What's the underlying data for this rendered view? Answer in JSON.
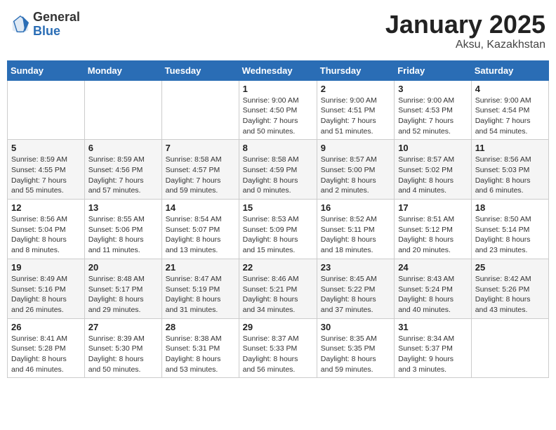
{
  "header": {
    "logo_general": "General",
    "logo_blue": "Blue",
    "month_title": "January 2025",
    "location": "Aksu, Kazakhstan"
  },
  "weekdays": [
    "Sunday",
    "Monday",
    "Tuesday",
    "Wednesday",
    "Thursday",
    "Friday",
    "Saturday"
  ],
  "weeks": [
    [
      {
        "day": "",
        "sunrise": "",
        "sunset": "",
        "daylight": ""
      },
      {
        "day": "",
        "sunrise": "",
        "sunset": "",
        "daylight": ""
      },
      {
        "day": "",
        "sunrise": "",
        "sunset": "",
        "daylight": ""
      },
      {
        "day": "1",
        "sunrise": "Sunrise: 9:00 AM",
        "sunset": "Sunset: 4:50 PM",
        "daylight": "Daylight: 7 hours and 50 minutes."
      },
      {
        "day": "2",
        "sunrise": "Sunrise: 9:00 AM",
        "sunset": "Sunset: 4:51 PM",
        "daylight": "Daylight: 7 hours and 51 minutes."
      },
      {
        "day": "3",
        "sunrise": "Sunrise: 9:00 AM",
        "sunset": "Sunset: 4:53 PM",
        "daylight": "Daylight: 7 hours and 52 minutes."
      },
      {
        "day": "4",
        "sunrise": "Sunrise: 9:00 AM",
        "sunset": "Sunset: 4:54 PM",
        "daylight": "Daylight: 7 hours and 54 minutes."
      }
    ],
    [
      {
        "day": "5",
        "sunrise": "Sunrise: 8:59 AM",
        "sunset": "Sunset: 4:55 PM",
        "daylight": "Daylight: 7 hours and 55 minutes."
      },
      {
        "day": "6",
        "sunrise": "Sunrise: 8:59 AM",
        "sunset": "Sunset: 4:56 PM",
        "daylight": "Daylight: 7 hours and 57 minutes."
      },
      {
        "day": "7",
        "sunrise": "Sunrise: 8:58 AM",
        "sunset": "Sunset: 4:57 PM",
        "daylight": "Daylight: 7 hours and 59 minutes."
      },
      {
        "day": "8",
        "sunrise": "Sunrise: 8:58 AM",
        "sunset": "Sunset: 4:59 PM",
        "daylight": "Daylight: 8 hours and 0 minutes."
      },
      {
        "day": "9",
        "sunrise": "Sunrise: 8:57 AM",
        "sunset": "Sunset: 5:00 PM",
        "daylight": "Daylight: 8 hours and 2 minutes."
      },
      {
        "day": "10",
        "sunrise": "Sunrise: 8:57 AM",
        "sunset": "Sunset: 5:02 PM",
        "daylight": "Daylight: 8 hours and 4 minutes."
      },
      {
        "day": "11",
        "sunrise": "Sunrise: 8:56 AM",
        "sunset": "Sunset: 5:03 PM",
        "daylight": "Daylight: 8 hours and 6 minutes."
      }
    ],
    [
      {
        "day": "12",
        "sunrise": "Sunrise: 8:56 AM",
        "sunset": "Sunset: 5:04 PM",
        "daylight": "Daylight: 8 hours and 8 minutes."
      },
      {
        "day": "13",
        "sunrise": "Sunrise: 8:55 AM",
        "sunset": "Sunset: 5:06 PM",
        "daylight": "Daylight: 8 hours and 11 minutes."
      },
      {
        "day": "14",
        "sunrise": "Sunrise: 8:54 AM",
        "sunset": "Sunset: 5:07 PM",
        "daylight": "Daylight: 8 hours and 13 minutes."
      },
      {
        "day": "15",
        "sunrise": "Sunrise: 8:53 AM",
        "sunset": "Sunset: 5:09 PM",
        "daylight": "Daylight: 8 hours and 15 minutes."
      },
      {
        "day": "16",
        "sunrise": "Sunrise: 8:52 AM",
        "sunset": "Sunset: 5:11 PM",
        "daylight": "Daylight: 8 hours and 18 minutes."
      },
      {
        "day": "17",
        "sunrise": "Sunrise: 8:51 AM",
        "sunset": "Sunset: 5:12 PM",
        "daylight": "Daylight: 8 hours and 20 minutes."
      },
      {
        "day": "18",
        "sunrise": "Sunrise: 8:50 AM",
        "sunset": "Sunset: 5:14 PM",
        "daylight": "Daylight: 8 hours and 23 minutes."
      }
    ],
    [
      {
        "day": "19",
        "sunrise": "Sunrise: 8:49 AM",
        "sunset": "Sunset: 5:16 PM",
        "daylight": "Daylight: 8 hours and 26 minutes."
      },
      {
        "day": "20",
        "sunrise": "Sunrise: 8:48 AM",
        "sunset": "Sunset: 5:17 PM",
        "daylight": "Daylight: 8 hours and 29 minutes."
      },
      {
        "day": "21",
        "sunrise": "Sunrise: 8:47 AM",
        "sunset": "Sunset: 5:19 PM",
        "daylight": "Daylight: 8 hours and 31 minutes."
      },
      {
        "day": "22",
        "sunrise": "Sunrise: 8:46 AM",
        "sunset": "Sunset: 5:21 PM",
        "daylight": "Daylight: 8 hours and 34 minutes."
      },
      {
        "day": "23",
        "sunrise": "Sunrise: 8:45 AM",
        "sunset": "Sunset: 5:22 PM",
        "daylight": "Daylight: 8 hours and 37 minutes."
      },
      {
        "day": "24",
        "sunrise": "Sunrise: 8:43 AM",
        "sunset": "Sunset: 5:24 PM",
        "daylight": "Daylight: 8 hours and 40 minutes."
      },
      {
        "day": "25",
        "sunrise": "Sunrise: 8:42 AM",
        "sunset": "Sunset: 5:26 PM",
        "daylight": "Daylight: 8 hours and 43 minutes."
      }
    ],
    [
      {
        "day": "26",
        "sunrise": "Sunrise: 8:41 AM",
        "sunset": "Sunset: 5:28 PM",
        "daylight": "Daylight: 8 hours and 46 minutes."
      },
      {
        "day": "27",
        "sunrise": "Sunrise: 8:39 AM",
        "sunset": "Sunset: 5:30 PM",
        "daylight": "Daylight: 8 hours and 50 minutes."
      },
      {
        "day": "28",
        "sunrise": "Sunrise: 8:38 AM",
        "sunset": "Sunset: 5:31 PM",
        "daylight": "Daylight: 8 hours and 53 minutes."
      },
      {
        "day": "29",
        "sunrise": "Sunrise: 8:37 AM",
        "sunset": "Sunset: 5:33 PM",
        "daylight": "Daylight: 8 hours and 56 minutes."
      },
      {
        "day": "30",
        "sunrise": "Sunrise: 8:35 AM",
        "sunset": "Sunset: 5:35 PM",
        "daylight": "Daylight: 8 hours and 59 minutes."
      },
      {
        "day": "31",
        "sunrise": "Sunrise: 8:34 AM",
        "sunset": "Sunset: 5:37 PM",
        "daylight": "Daylight: 9 hours and 3 minutes."
      },
      {
        "day": "",
        "sunrise": "",
        "sunset": "",
        "daylight": ""
      }
    ]
  ]
}
